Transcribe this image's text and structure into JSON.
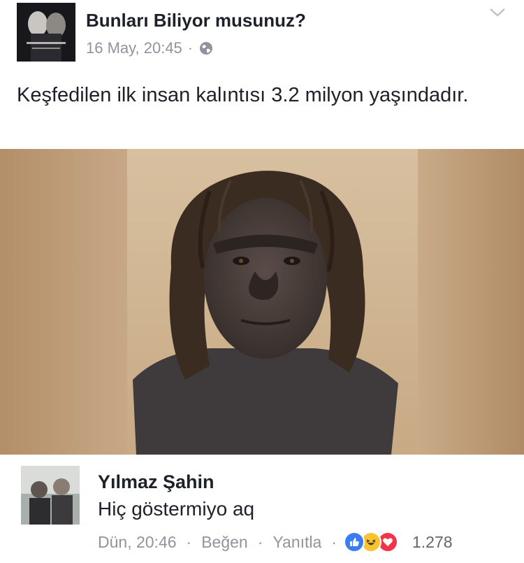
{
  "post": {
    "page_name": "Bunları Biliyor musunuz?",
    "timestamp": "16 May, 20:45",
    "separator": "·",
    "audience_icon": "globe-icon",
    "text": "Keşfedilen ilk insan kalıntısı 3.2 milyon yaşındadır.",
    "menu_icon": "chevron-down-icon"
  },
  "comment": {
    "author": "Yılmaz Şahin",
    "text": "Hiç göstermiyo aq",
    "time": "Dün, 20:46",
    "like_label": "Beğen",
    "reply_label": "Yanıtla",
    "separator": "·",
    "reactions": [
      "like-icon",
      "haha-icon",
      "love-icon"
    ],
    "reaction_count": "1.278"
  },
  "colors": {
    "text": "#1d2129",
    "meta": "#90949c",
    "like_blue": "#3b7cf0",
    "haha_yellow": "#f7c531",
    "love_red": "#f0354b"
  }
}
